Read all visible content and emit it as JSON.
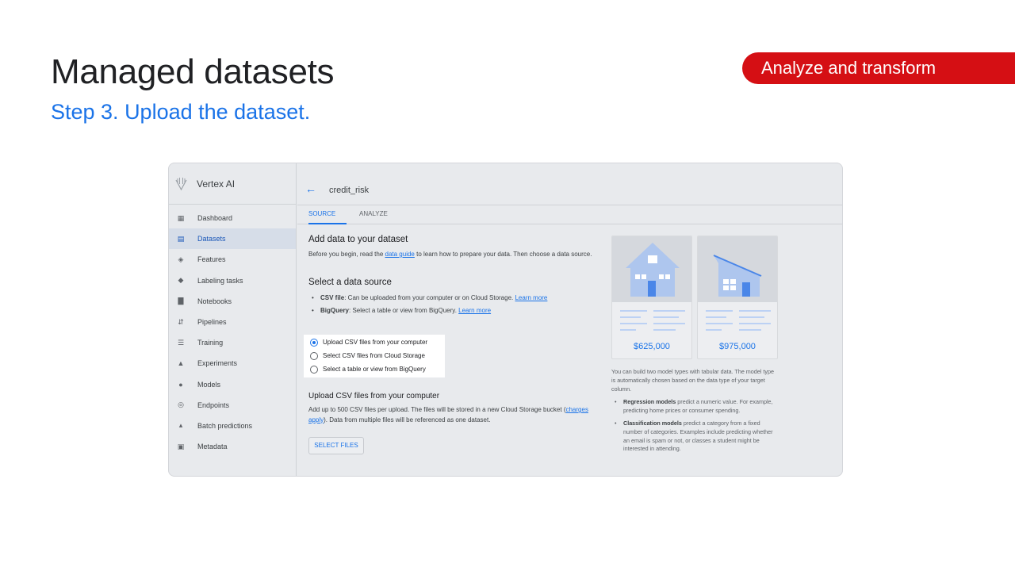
{
  "slide": {
    "title": "Managed datasets",
    "subtitle": "Step 3. Upload the dataset.",
    "section_badge": "Analyze and transform"
  },
  "app": {
    "name": "Vertex AI",
    "logo_icon": "vertex-ai-logo-icon"
  },
  "sidebar": {
    "items": [
      {
        "label": "Dashboard",
        "icon": "dashboard-icon",
        "active": false
      },
      {
        "label": "Datasets",
        "icon": "datasets-icon",
        "active": true
      },
      {
        "label": "Features",
        "icon": "features-icon",
        "active": false
      },
      {
        "label": "Labeling tasks",
        "icon": "label-icon",
        "active": false
      },
      {
        "label": "Notebooks",
        "icon": "notebook-icon",
        "active": false
      },
      {
        "label": "Pipelines",
        "icon": "pipelines-icon",
        "active": false
      },
      {
        "label": "Training",
        "icon": "training-icon",
        "active": false
      },
      {
        "label": "Experiments",
        "icon": "flask-icon",
        "active": false
      },
      {
        "label": "Models",
        "icon": "lightbulb-icon",
        "active": false
      },
      {
        "label": "Endpoints",
        "icon": "endpoints-icon",
        "active": false
      },
      {
        "label": "Batch predictions",
        "icon": "bell-icon",
        "active": false
      },
      {
        "label": "Metadata",
        "icon": "metadata-icon",
        "active": false
      }
    ]
  },
  "header": {
    "back_icon": "arrow-back-icon",
    "dataset_name": "credit_risk"
  },
  "tabs": [
    {
      "label": "SOURCE",
      "active": true
    },
    {
      "label": "ANALYZE",
      "active": false
    }
  ],
  "main": {
    "add_heading": "Add data to your dataset",
    "intro_pre": "Before you begin, read the ",
    "intro_link": "data guide",
    "intro_post": " to learn how to prepare your data. Then choose a data source.",
    "source_heading": "Select a data source",
    "sources": [
      {
        "name": "CSV file",
        "text": ": Can be uploaded from your computer or on Cloud Storage. ",
        "link": "Learn more"
      },
      {
        "name": "BigQuery",
        "text": ": Select a table or view from BigQuery. ",
        "link": "Learn more"
      }
    ],
    "options": [
      {
        "label": "Upload CSV files from your computer",
        "selected": true
      },
      {
        "label": "Select CSV files from Cloud Storage",
        "selected": false
      },
      {
        "label": "Select a table or view from BigQuery",
        "selected": false
      }
    ],
    "upload_heading": "Upload CSV files from your computer",
    "upload_pre": "Add up to 500 CSV files per upload. The files will be stored in a new Cloud Storage bucket (",
    "upload_link": "charges apply",
    "upload_post": "). Data from multiple files will be referenced as one dataset.",
    "select_button": "SELECT FILES"
  },
  "illustration": {
    "cards": [
      {
        "price": "$625,000",
        "icon": "house-icon"
      },
      {
        "price": "$975,000",
        "icon": "house-icon"
      }
    ],
    "colors": {
      "house": "#aec6ee",
      "door": "#4a86e8",
      "lines": "#8ab4f8"
    }
  },
  "info": {
    "intro": "You can build two model types with tabular data. The model type is automatically chosen based on the data type of your target column.",
    "items": [
      {
        "term": "Regression models",
        "text": " predict a numeric value. For example, predicting home prices or consumer spending."
      },
      {
        "term": "Classification models",
        "text": " predict a category from a fixed number of categories. Examples include predicting whether an email is spam or not, or classes a student might be interested in attending."
      }
    ]
  }
}
